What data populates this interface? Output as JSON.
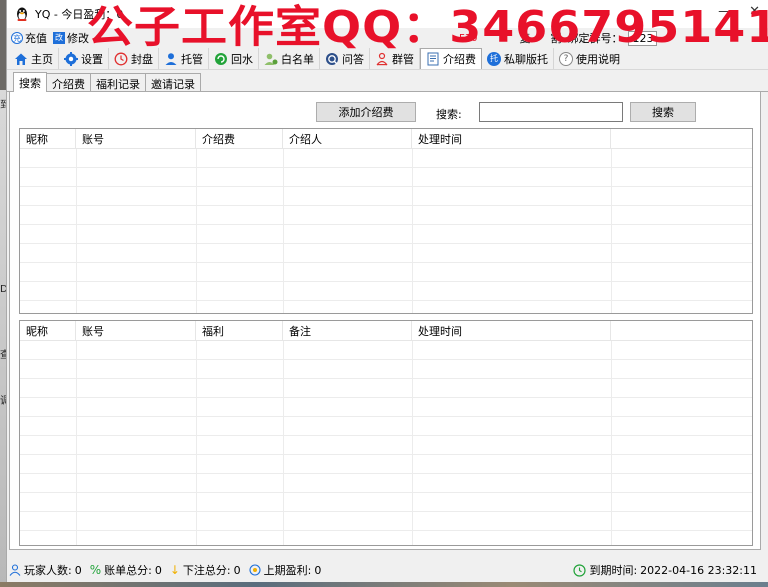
{
  "window": {
    "title": "YQ - 今日盈利：0",
    "controls": {
      "minimize": "—",
      "close": "✕"
    }
  },
  "watermark": "公子工作室QQ：3466795141",
  "row2": {
    "recharge": "充值",
    "recharge_icon_text": "充",
    "modify_icon_text": "改",
    "modify_label": "修改",
    "f10_label": "F10",
    "copy_label": "复",
    "cut_label": "割",
    "bind_label": "绑定群号：",
    "group_value": "123"
  },
  "toolbar": [
    {
      "label": "主页",
      "icon": "home-icon"
    },
    {
      "label": "设置",
      "icon": "gear-icon"
    },
    {
      "label": "封盘",
      "icon": "clock-icon"
    },
    {
      "label": "托管",
      "icon": "user-icon"
    },
    {
      "label": "回水",
      "icon": "recycle-icon"
    },
    {
      "label": "白名单",
      "icon": "whitelist-icon"
    },
    {
      "label": "问答",
      "icon": "question-icon"
    },
    {
      "label": "群管",
      "icon": "group-icon"
    },
    {
      "label": "介绍费",
      "icon": "document-icon"
    },
    {
      "label": "私聊版托",
      "icon": "chat-icon",
      "icon_text": "托"
    },
    {
      "label": "使用说明",
      "icon": "help-icon",
      "icon_text": "?"
    }
  ],
  "subtabs": [
    "搜索",
    "介绍费",
    "福利记录",
    "邀请记录"
  ],
  "search": {
    "add_button": "添加介绍费",
    "label": "搜索:",
    "input_value": "",
    "search_button": "搜索"
  },
  "table1": {
    "columns": [
      "昵称",
      "账号",
      "介绍费",
      "介绍人",
      "处理时间",
      ""
    ]
  },
  "table2": {
    "columns": [
      "昵称",
      "账号",
      "福利",
      "备注",
      "处理时间",
      ""
    ]
  },
  "status": {
    "players_label": "玩家人数:",
    "players_value": "0",
    "bill_label": "账单总分:",
    "bill_value": "0",
    "bet_label": "下注总分:",
    "bet_value": "0",
    "profit_label": "上期盈利:",
    "profit_value": "0",
    "expire_label": "到期时间:",
    "expire_value": "2022-04-16 23:32:11"
  },
  "desk_fragments": [
    "到",
    "D",
    "查",
    "调"
  ],
  "colors": {
    "watermark": "#e8112a",
    "accent_blue": "#1e6fd9"
  }
}
